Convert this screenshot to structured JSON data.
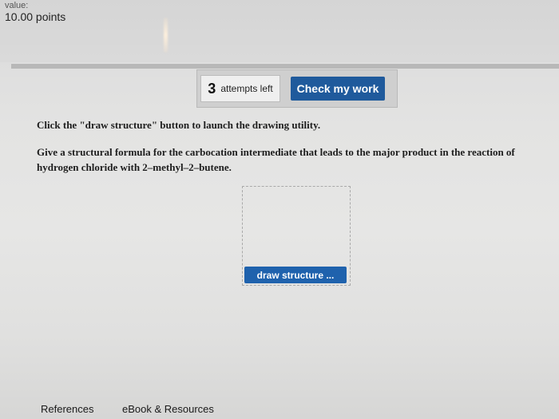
{
  "header": {
    "value_label": "value:",
    "points": "10.00 points"
  },
  "attempts": {
    "count": "3",
    "label": "attempts left"
  },
  "check_button": "Check my work",
  "instructions": {
    "line1": "Click the \"draw structure\" button to launch the drawing utility.",
    "question": "Give a structural formula for the carbocation intermediate that leads to the major product in the reaction of hydrogen chloride with 2–methyl–2–butene."
  },
  "draw_button": "draw structure ...",
  "footer": {
    "references": "References",
    "ebook": "eBook & Resources"
  },
  "colors": {
    "button_blue": "#1f5a9c",
    "draw_button_blue": "#1f62ad",
    "panel_gray": "#cfcfcf"
  }
}
